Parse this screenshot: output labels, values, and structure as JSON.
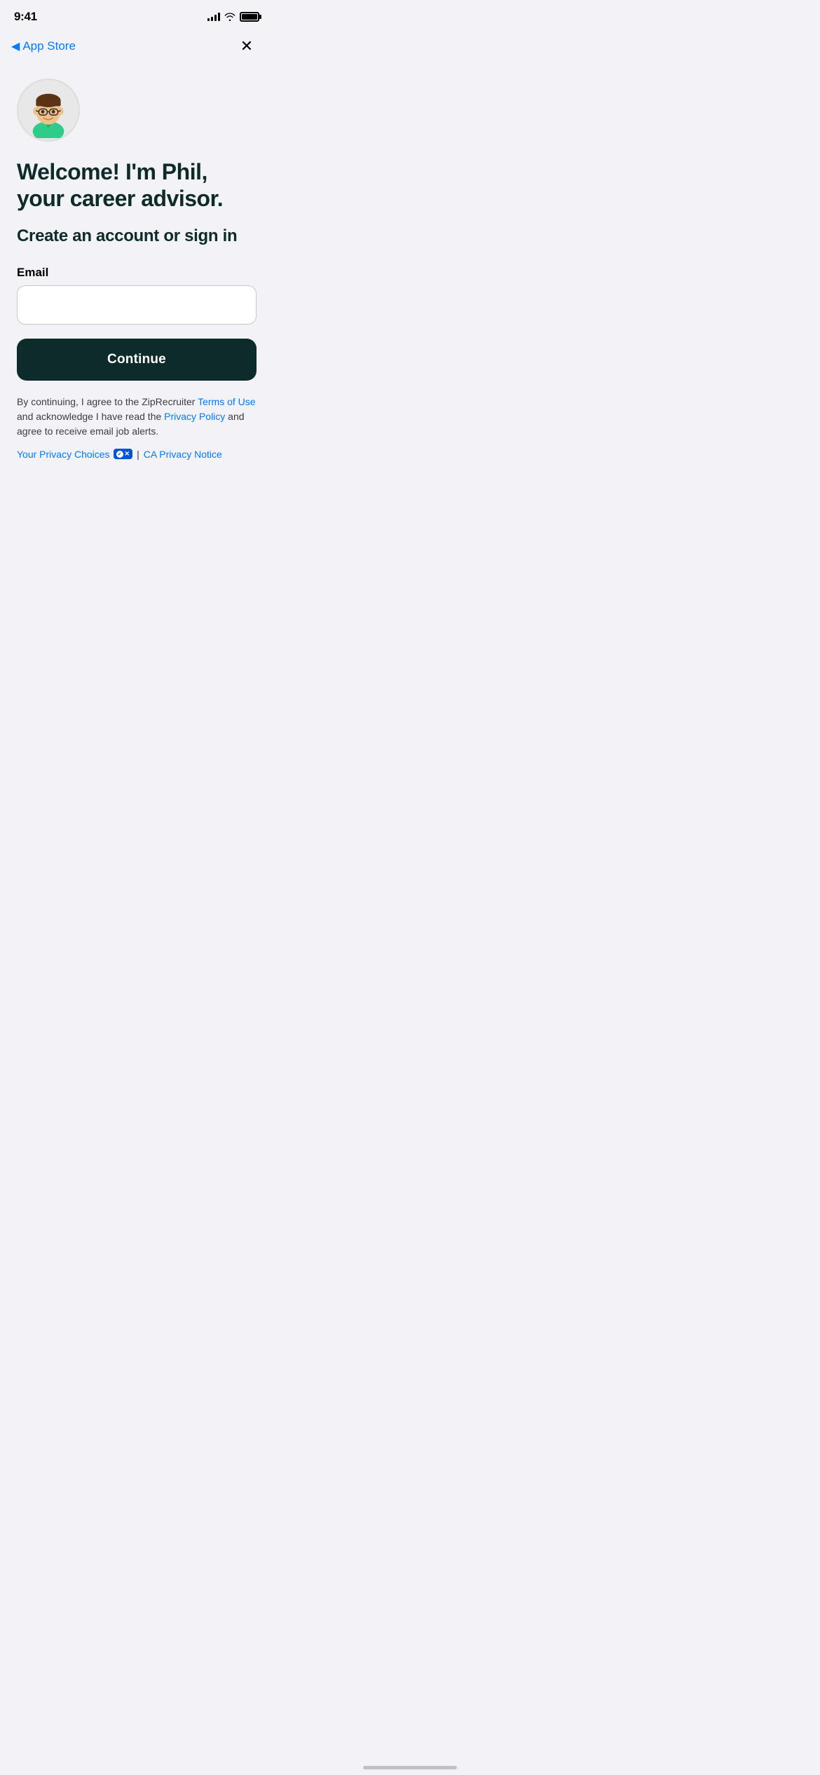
{
  "statusBar": {
    "time": "9:41",
    "back": "App Store"
  },
  "header": {
    "close_label": "×"
  },
  "avatar": {
    "alt": "Phil career advisor avatar"
  },
  "content": {
    "welcome_title": "Welcome! I'm Phil, your career advisor.",
    "subtitle": "Create an account or sign in",
    "email_label": "Email",
    "email_placeholder": "",
    "continue_label": "Continue"
  },
  "terms": {
    "prefix": "By continuing, I agree to the ZipRecruiter ",
    "terms_link_text": "Terms of Use",
    "middle": " and acknowledge I have read the ",
    "privacy_link_text": "Privacy Policy",
    "suffix": " and agree to receive email job alerts."
  },
  "privacyRow": {
    "choices_label": "Your Privacy Choices",
    "divider": "|",
    "ca_notice_label": "CA Privacy Notice"
  },
  "colors": {
    "accent": "#007aff",
    "dark": "#0d2b2b",
    "text": "#3c3c43"
  }
}
